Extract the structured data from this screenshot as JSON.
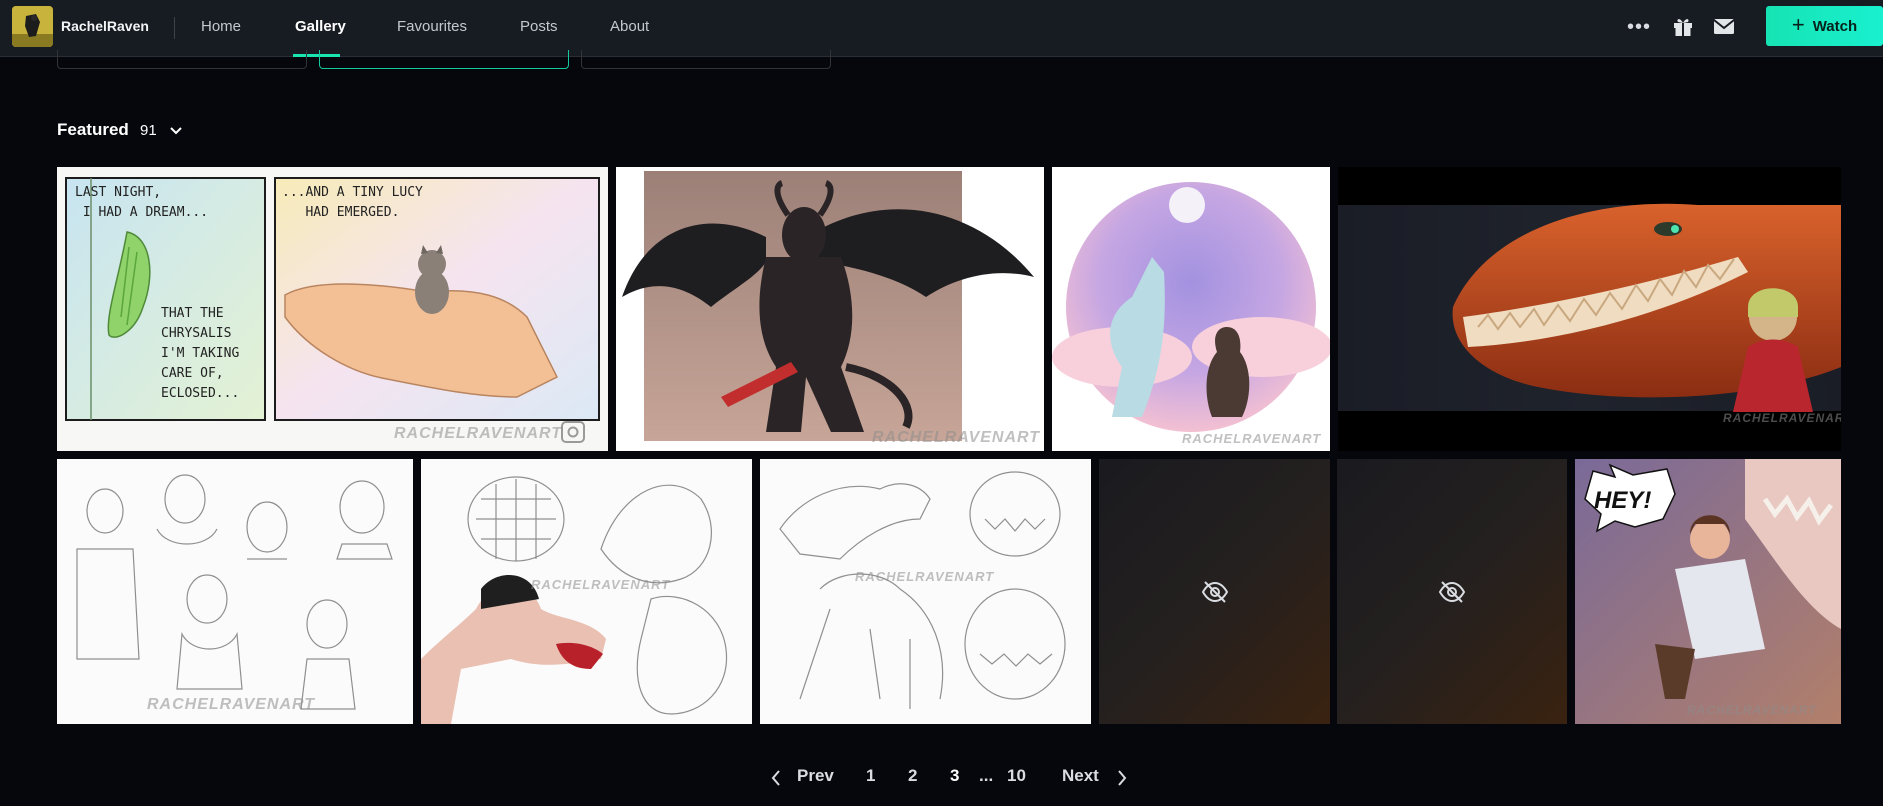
{
  "header": {
    "username": "RachelRaven",
    "nav": [
      "Home",
      "Gallery",
      "Favourites",
      "Posts",
      "About"
    ],
    "active_tab": "Gallery",
    "more_icon": "more-horizontal-icon",
    "gift_icon": "gift-icon",
    "mail_icon": "mail-icon",
    "watch_label": "Watch",
    "accent": "#19e6b4"
  },
  "gallery": {
    "title": "Featured",
    "count": "91",
    "items": [
      {
        "title": "Chrysalis comic",
        "panel1": "LAST NIGHT,\n I HAD A DREAM...",
        "panel1b": "THAT THE\nCHRYSALIS\nI'M TAKING\nCARE OF,\nECLOSED...",
        "panel2": "...AND A TINY LUCY\n   HAD EMERGED."
      },
      {
        "title": "Winged demon"
      },
      {
        "title": "Howling wolves under moon"
      },
      {
        "title": "Dragon and girl"
      },
      {
        "title": "Character face sketches"
      },
      {
        "title": "Muzzled beast sketches"
      },
      {
        "title": "Creature sketches"
      },
      {
        "title": "Hidden deviation 1",
        "hidden": true
      },
      {
        "title": "Hidden deviation 2",
        "hidden": true
      },
      {
        "title": "Hey comic",
        "bubble": "HEY!"
      }
    ],
    "watermark": "RACHELRAVENART"
  },
  "pagination": {
    "prev": "Prev",
    "pages": [
      "1",
      "2",
      "3"
    ],
    "current": "3",
    "ellipsis": "...",
    "last": "10",
    "next": "Next"
  }
}
